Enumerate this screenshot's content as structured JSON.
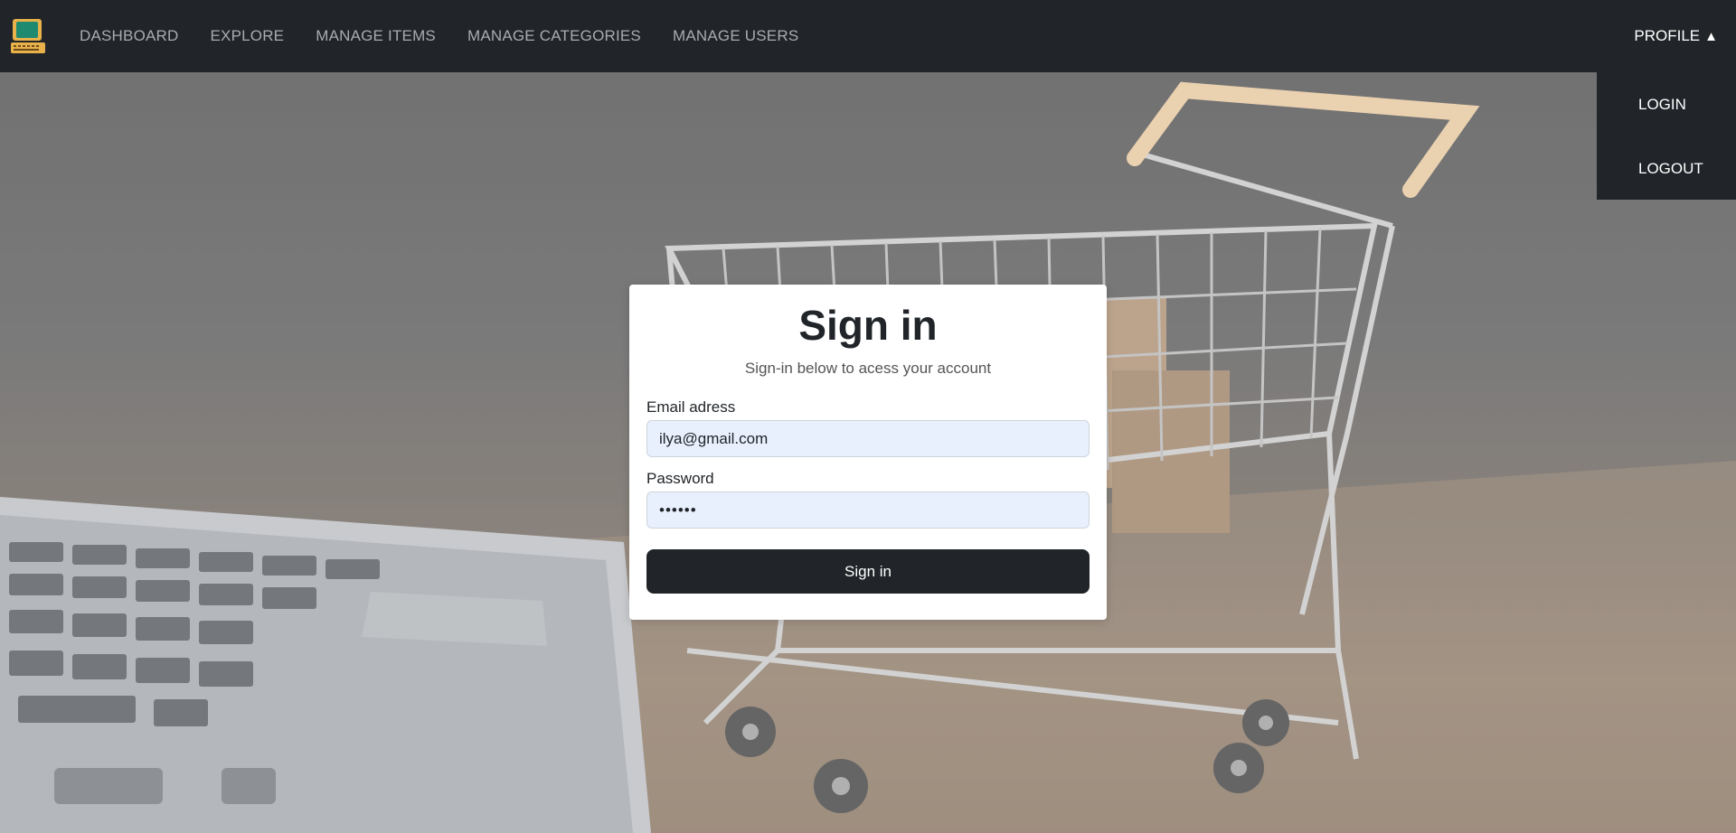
{
  "nav": {
    "brand_icon": "computer-icon",
    "links": [
      {
        "label": "DASHBOARD"
      },
      {
        "label": "EXPLORE"
      },
      {
        "label": "MANAGE ITEMS"
      },
      {
        "label": "MANAGE CATEGORIES"
      },
      {
        "label": "MANAGE USERS"
      }
    ],
    "profile": {
      "label": "PROFILE",
      "caret": "▲",
      "items": [
        {
          "label": "LOGIN"
        },
        {
          "label": "LOGOUT"
        }
      ]
    }
  },
  "signin": {
    "title": "Sign in",
    "subtitle": "Sign-in below to acess your account",
    "email_label": "Email adress",
    "email_value": "ilya@gmail.com",
    "password_label": "Password",
    "password_value": "••••••",
    "button_label": "Sign in"
  },
  "colors": {
    "navbar": "#212529",
    "nav_link": "#a8abaf",
    "input_bg": "#e8f0fe",
    "button": "#212529"
  }
}
